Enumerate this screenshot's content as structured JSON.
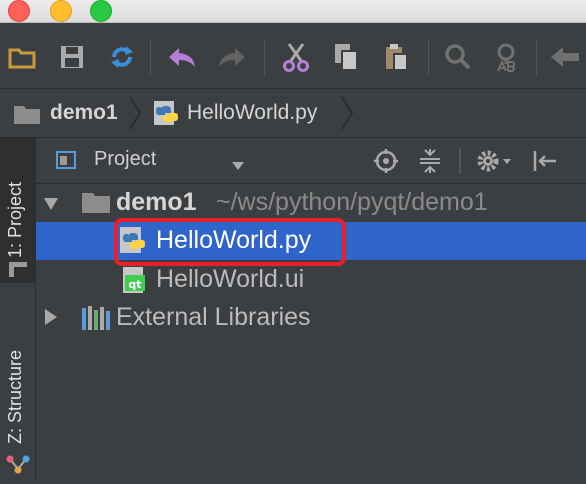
{
  "window": {
    "traffic_lights": [
      {
        "name": "close",
        "color": "#fe5f57"
      },
      {
        "name": "minimize",
        "color": "#febc2e"
      },
      {
        "name": "zoom",
        "color": "#28c840"
      }
    ]
  },
  "breadcrumb": {
    "project": "demo1",
    "file": "HelloWorld.py"
  },
  "sidebar": {
    "project_tab": "1: Project",
    "structure_tab": "Z: Structure"
  },
  "project_panel": {
    "view_selector": "Project",
    "tree": {
      "root_name": "demo1",
      "root_path": "~/ws/python/pyqt/demo1",
      "files": [
        {
          "name": "HelloWorld.py",
          "selected": true,
          "icon": "python-file-icon"
        },
        {
          "name": "HelloWorld.ui",
          "selected": false,
          "icon": "qt-ui-file-icon"
        }
      ],
      "external": "External Libraries"
    }
  },
  "colors": {
    "selection": "#2f65ca",
    "highlight_border": "#e8202a",
    "ide_background": "#3c3f41"
  }
}
